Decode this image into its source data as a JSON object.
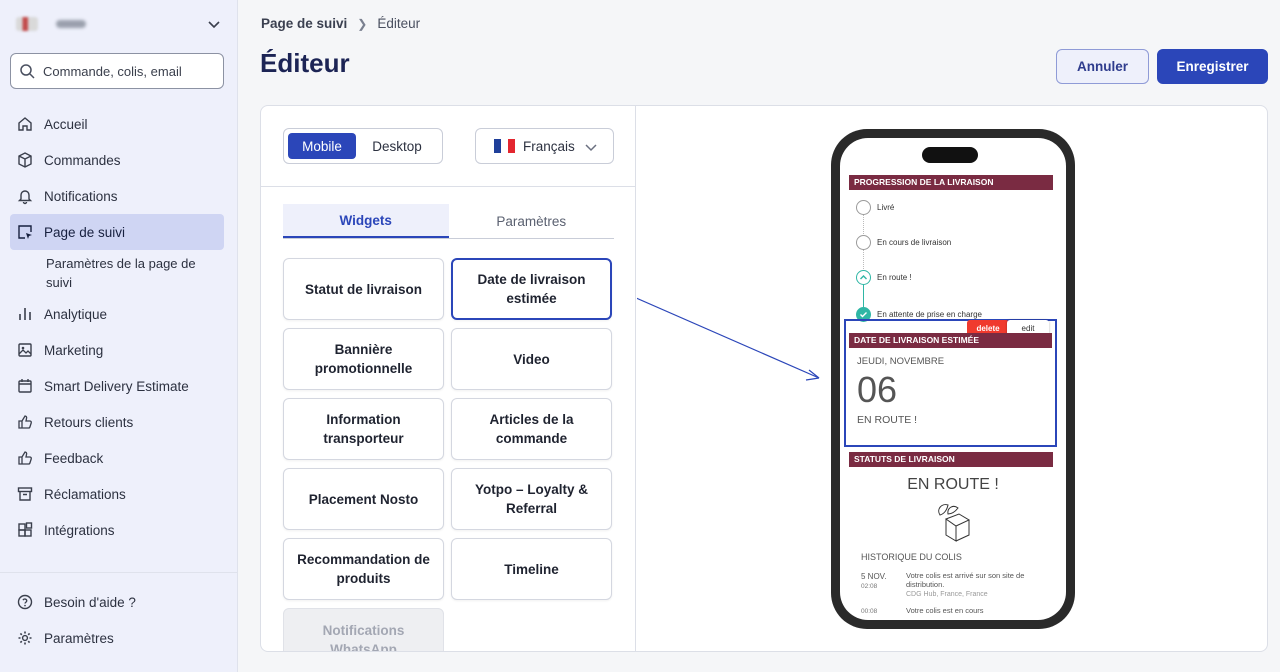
{
  "sidebar": {
    "search_placeholder": "Commande, colis, email",
    "items": [
      {
        "label": "Accueil",
        "icon": "home-icon"
      },
      {
        "label": "Commandes",
        "icon": "box-icon"
      },
      {
        "label": "Notifications",
        "icon": "bell-icon"
      },
      {
        "label": "Page de suivi",
        "icon": "cursor-page-icon",
        "active": true
      },
      {
        "label": "Paramètres de la page de suivi",
        "sub": true
      },
      {
        "label": "Analytique",
        "icon": "bar-chart-icon"
      },
      {
        "label": "Marketing",
        "icon": "image-icon"
      },
      {
        "label": "Smart Delivery Estimate",
        "icon": "calendar-icon"
      },
      {
        "label": "Retours clients",
        "icon": "thumbs-up-icon"
      },
      {
        "label": "Feedback",
        "icon": "thumbs-up-icon"
      },
      {
        "label": "Réclamations",
        "icon": "archive-icon"
      },
      {
        "label": "Intégrations",
        "icon": "puzzle-icon"
      }
    ],
    "bottom": [
      {
        "label": "Besoin d'aide ?",
        "icon": "help-icon"
      },
      {
        "label": "Paramètres",
        "icon": "gear-icon"
      }
    ]
  },
  "header": {
    "breadcrumb_parent": "Page de suivi",
    "breadcrumb_current": "Éditeur",
    "title": "Éditeur",
    "cancel_label": "Annuler",
    "save_label": "Enregistrer"
  },
  "editor": {
    "view_mobile": "Mobile",
    "view_desktop": "Desktop",
    "language": "Français",
    "tab_widgets": "Widgets",
    "tab_settings": "Paramètres",
    "widgets": [
      {
        "label": "Statut de livraison"
      },
      {
        "label": "Date de livraison estimée",
        "selected": true
      },
      {
        "label": "Bannière promotionnelle"
      },
      {
        "label": "Video"
      },
      {
        "label": "Information transporteur"
      },
      {
        "label": "Articles de la commande"
      },
      {
        "label": "Placement Nosto"
      },
      {
        "label": "Yotpo – Loyalty & Referral"
      },
      {
        "label": "Recommandation de produits"
      },
      {
        "label": "Timeline"
      },
      {
        "label": "Notifications WhatsApp",
        "disabled": true
      }
    ]
  },
  "preview": {
    "progress_title": "PROGRESSION DE LA LIVRAISON",
    "steps": [
      "Livré",
      "En cours de livraison",
      "En route !",
      "En attente de prise en charge"
    ],
    "delete_label": "delete",
    "edit_label": "edit",
    "estimate_title": "DATE DE LIVRAISON ESTIMÉE",
    "estimate_day": "JEUDI, NOVEMBRE",
    "estimate_date": "06",
    "estimate_status": "EN ROUTE !",
    "status_title": "STATUTS DE LIVRAISON",
    "status_big": "EN ROUTE !",
    "history_title": "HISTORIQUE DU COLIS",
    "history": [
      {
        "date": "5 NOV.",
        "time": "02:08",
        "text": "Votre colis est arrivé sur son site de distribution.",
        "place": "CDG Hub, France, France"
      },
      {
        "date": "",
        "time": "00:08",
        "text": "Votre colis est en cours",
        "place": ""
      }
    ]
  },
  "colors": {
    "accent": "#2b46b9",
    "sidebar_bg": "#eef0fb",
    "active_item": "#cfd5f3",
    "preview_bar": "#7a2b42",
    "progress_teal": "#2fb6a5",
    "delete_red": "#f03a2e"
  }
}
